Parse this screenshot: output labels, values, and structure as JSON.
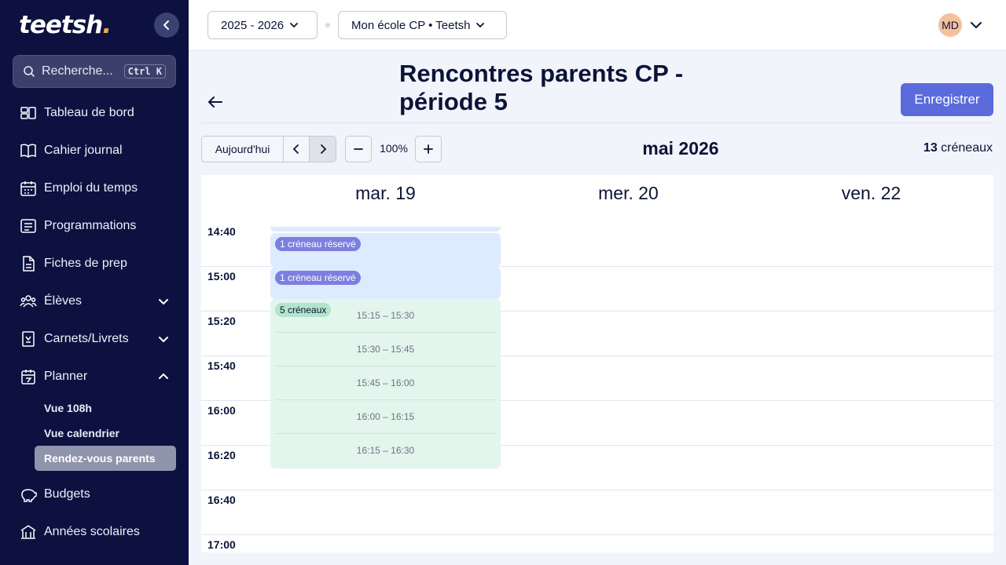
{
  "app": {
    "logo": "teetsh"
  },
  "sidebar": {
    "search": {
      "placeholder": "Recherche...",
      "shortcut": "Ctrl K"
    },
    "items": [
      {
        "label": "Tableau de bord",
        "icon": "dashboard-icon"
      },
      {
        "label": "Cahier journal",
        "icon": "book-icon"
      },
      {
        "label": "Emploi du temps",
        "icon": "calendar-icon"
      },
      {
        "label": "Programmations",
        "icon": "list-icon"
      },
      {
        "label": "Fiches de prep",
        "icon": "document-icon"
      },
      {
        "label": "Élèves",
        "icon": "students-icon"
      },
      {
        "label": "Carnets/Livrets",
        "icon": "notebook-icon"
      },
      {
        "label": "Planner",
        "icon": "planner-icon"
      },
      {
        "label": "Budgets",
        "icon": "piggy-bank-icon"
      },
      {
        "label": "Années scolaires",
        "icon": "school-icon"
      }
    ],
    "planner_sub": [
      {
        "label": "Vue 108h"
      },
      {
        "label": "Vue calendrier"
      },
      {
        "label": "Rendez-vous parents",
        "active": true
      }
    ]
  },
  "topbar": {
    "year_select": "2025 - 2026",
    "school_select": "Mon école CP • Teetsh",
    "avatar_initials": "MD"
  },
  "header": {
    "title": "Rencontres parents CP - période 5",
    "save_label": "Enregistrer"
  },
  "toolbar": {
    "today_label": "Aujourd'hui",
    "zoom": "100%",
    "month": "mai 2026",
    "slot_count": "13",
    "slot_count_label": "créneaux"
  },
  "calendar": {
    "days": [
      "mar. 19",
      "mer. 20",
      "ven. 22"
    ],
    "times": [
      "14:40",
      "15:00",
      "15:20",
      "15:40",
      "16:00",
      "16:20",
      "16:40",
      "17:00"
    ],
    "reserved_badge": "1 créneau réservé",
    "group_badge": "5 créneaux",
    "slots": [
      "15:15 – 15:30",
      "15:30 – 15:45",
      "15:45 – 16:00",
      "16:00 – 16:15",
      "16:15 – 16:30"
    ]
  },
  "colors": {
    "sidebar_bg": "#0d1140",
    "accent": "#5b6bdc",
    "reserved_bg": "#deeaff",
    "available_bg": "#e3f5ec"
  }
}
